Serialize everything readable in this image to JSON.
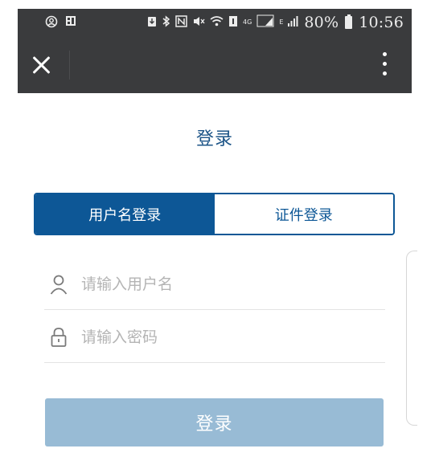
{
  "status_bar": {
    "left_icons": [
      "account-circle-icon",
      "sim-card-icon"
    ],
    "right_icons": [
      "download-icon",
      "bluetooth-icon",
      "nfc-icon",
      "mute-icon",
      "wifi-icon",
      "volte-icon",
      "lte-icon",
      "dual-sim-signal-icon",
      "signal-icon",
      "battery-icon"
    ],
    "network_4g": "4G",
    "network_dual": "4G 2G",
    "network_e": "E",
    "battery": "80%",
    "time": "10:56"
  },
  "app_bar": {
    "close_icon": "close-icon",
    "more_icon": "more-vertical-icon",
    "background": "#3a3b3d"
  },
  "page": {
    "title": "登录"
  },
  "tabs": [
    {
      "label": "用户名登录",
      "active": true
    },
    {
      "label": "证件登录",
      "active": false
    }
  ],
  "form": {
    "username": {
      "placeholder": "请输入用户名",
      "value": "",
      "icon": "user-icon"
    },
    "password": {
      "placeholder": "请输入密码",
      "value": "",
      "icon": "lock-icon"
    },
    "submit_label": "登录"
  },
  "colors": {
    "primary": "#0d5796",
    "title": "#1c5487",
    "button_disabled": "#98bbd5",
    "placeholder": "#b4b4b4"
  }
}
